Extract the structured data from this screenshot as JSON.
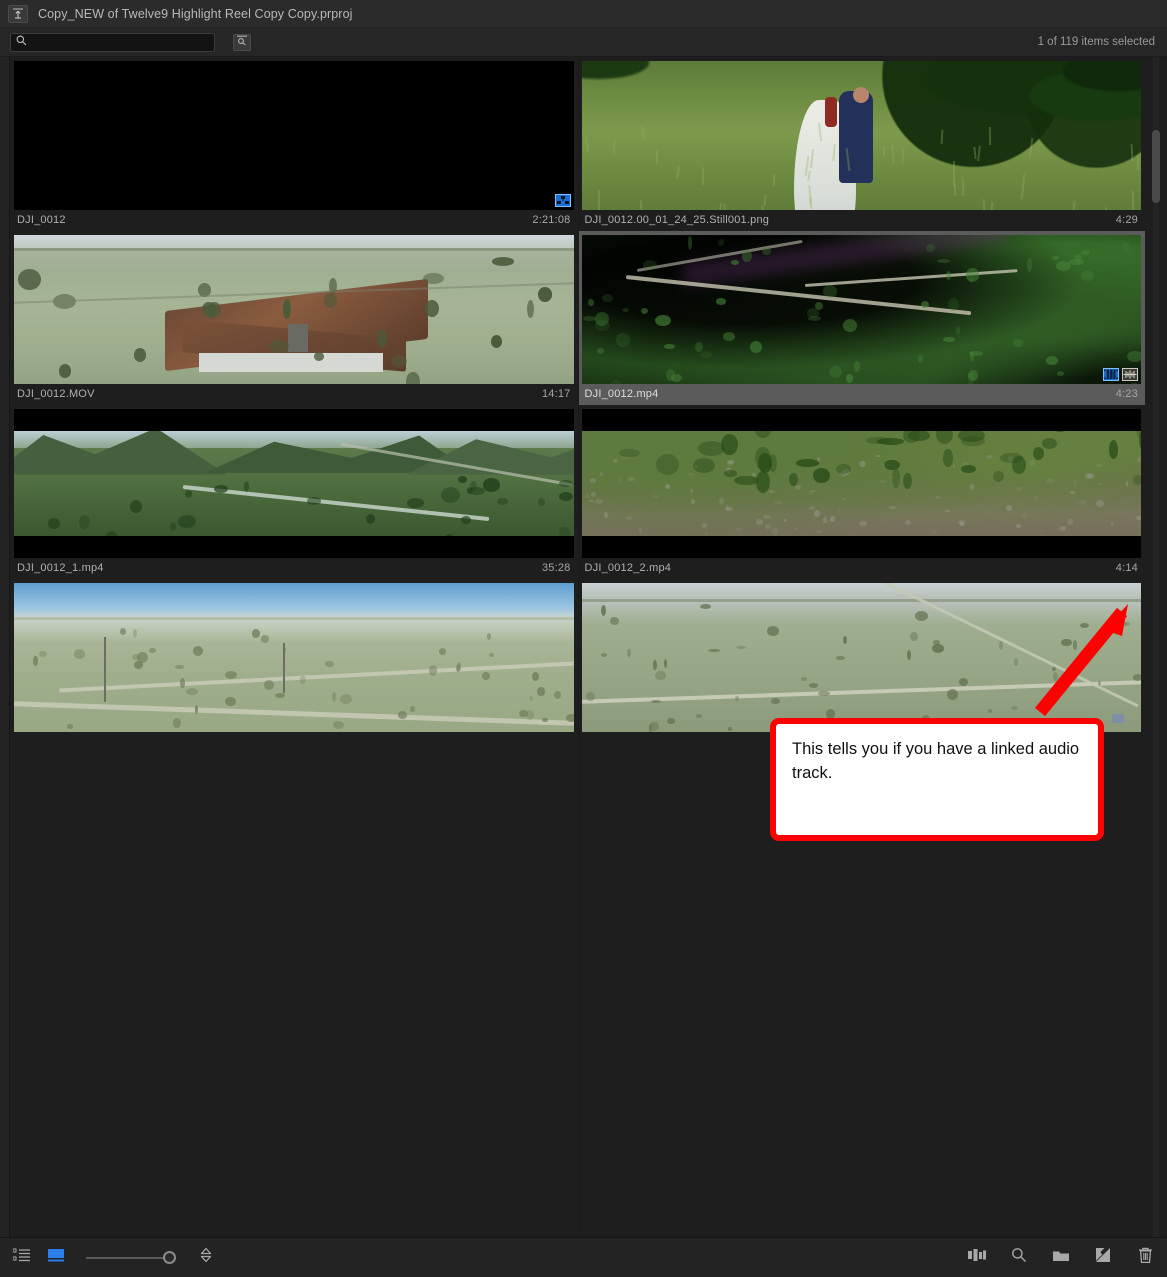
{
  "titlebar": {
    "nav_up_icon": "navigate-up-icon",
    "project_title": "Copy_NEW of Twelve9 Highlight Reel Copy Copy.prproj"
  },
  "search": {
    "value": "",
    "placeholder": "",
    "search_icon": "search-icon",
    "find_button_icon": "find-icon"
  },
  "status": {
    "selection": "1 of 119 items selected"
  },
  "grid": {
    "items": [
      {
        "name": "DJI_0012",
        "duration": "2:21:08",
        "selected": false,
        "art": "black",
        "badges": [
          "sequence-icon"
        ]
      },
      {
        "name": "DJI_0012.00_01_24_25.Still001.png",
        "duration": "4:29",
        "selected": false,
        "art": "wedding",
        "badges": []
      },
      {
        "name": "DJI_0012.MOV",
        "duration": "14:17",
        "selected": false,
        "art": "house",
        "badges": []
      },
      {
        "name": "DJI_0012.mp4",
        "duration": "4:23",
        "selected": true,
        "art": "forest",
        "badges": [
          "video-track-icon",
          "audio-track-icon"
        ]
      },
      {
        "name": "DJI_0012_1.mp4",
        "duration": "35:28",
        "selected": false,
        "art": "valley",
        "badges": [
          "video-track-icon",
          "audio-track-icon"
        ]
      },
      {
        "name": "DJI_0012_2.mp4",
        "duration": "4:14",
        "selected": false,
        "art": "scrub",
        "badges": [
          "video-track-icon",
          "audio-track-icon"
        ]
      },
      {
        "name": "",
        "duration": "",
        "selected": false,
        "art": "prairie",
        "badges": []
      },
      {
        "name": "",
        "duration": "",
        "selected": false,
        "art": "prairie2",
        "badges": []
      }
    ]
  },
  "annotation": {
    "text": "This tells you if you have a linked audio track.",
    "border_color": "#ff0000",
    "arrow_color": "#ff0000"
  },
  "bottom_toolbar": {
    "left": [
      {
        "icon": "list-view-icon",
        "active": false
      },
      {
        "icon": "icon-view-icon",
        "active": true
      },
      {
        "icon": "thumbnail-size-slider",
        "active": false
      },
      {
        "icon": "sort-icon",
        "active": false
      }
    ],
    "right": [
      {
        "icon": "freeform-view-icon"
      },
      {
        "icon": "find-icon"
      },
      {
        "icon": "new-bin-icon"
      },
      {
        "icon": "new-item-icon"
      },
      {
        "icon": "delete-icon"
      }
    ],
    "accent_color": "#2a7fe8"
  }
}
